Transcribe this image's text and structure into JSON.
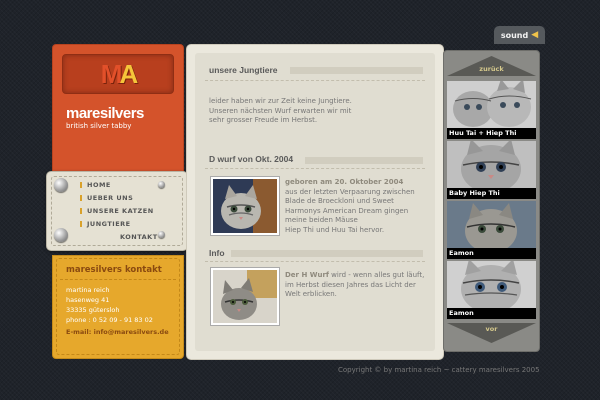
{
  "header": {
    "sound_label": "sound"
  },
  "brand": {
    "logo_m": "M",
    "logo_a": "A",
    "title": "maresilvers",
    "subtitle": "british silver tabby"
  },
  "nav": {
    "items": [
      {
        "label": "HOME"
      },
      {
        "label": "UEBER UNS"
      },
      {
        "label": "UNSERE KATZEN"
      },
      {
        "label": "JUNGTIERE"
      },
      {
        "label": "KONTAKT"
      }
    ]
  },
  "contact": {
    "title": "maresilvers kontakt",
    "name": "martina reich",
    "street": "hasenweg 41",
    "city": "33335 gütersloh",
    "phone": "phone : 0 52 09 - 91 83 02",
    "email": "E-mail: info@maresilvers.de"
  },
  "main": {
    "section1": {
      "title": "unsere Jungtiere",
      "lines": [
        "leider haben wir zur Zeit keine Jungtiere.",
        "Unseren nächsten Wurf erwarten wir mit",
        "sehr grosser Freude im  Herbst."
      ]
    },
    "section2": {
      "title": "D wurf von Okt. 2004",
      "lead": "geboren am 20. Oktober 2004",
      "lines": [
        "aus der letzten Verpaarung zwischen",
        "Blade de Broeckloni und Sweet",
        "Harmonys American Dream gingen",
        "meine beiden Mäuse",
        "Hiep Thi und Huu Tai hervor."
      ]
    },
    "section3": {
      "title": "Info",
      "lead": "Der H Wurf",
      "lead_rest": " wird - wenn alles gut läuft,",
      "lines": [
        "im Herbst diesen Jahres das Licht der",
        "Welt erblicken."
      ]
    }
  },
  "gallery": {
    "up_label": "zurück",
    "down_label": "vor",
    "items": [
      {
        "caption": "Huu Tai + Hiep Thi"
      },
      {
        "caption": "Baby Hiep Thi"
      },
      {
        "caption": "Eamon"
      },
      {
        "caption": "Eamon"
      }
    ]
  },
  "footer": {
    "copyright": "Copyright © by martina reich ~ cattery maresilvers 2005"
  },
  "colors": {
    "background": "#1f232a",
    "brand_orange": "#d4532b",
    "contact_yellow": "#e6a82c",
    "panel_cream": "#ebe8dd",
    "gallery_gray": "#8a8a86",
    "accent_gold": "#f5c53a"
  }
}
